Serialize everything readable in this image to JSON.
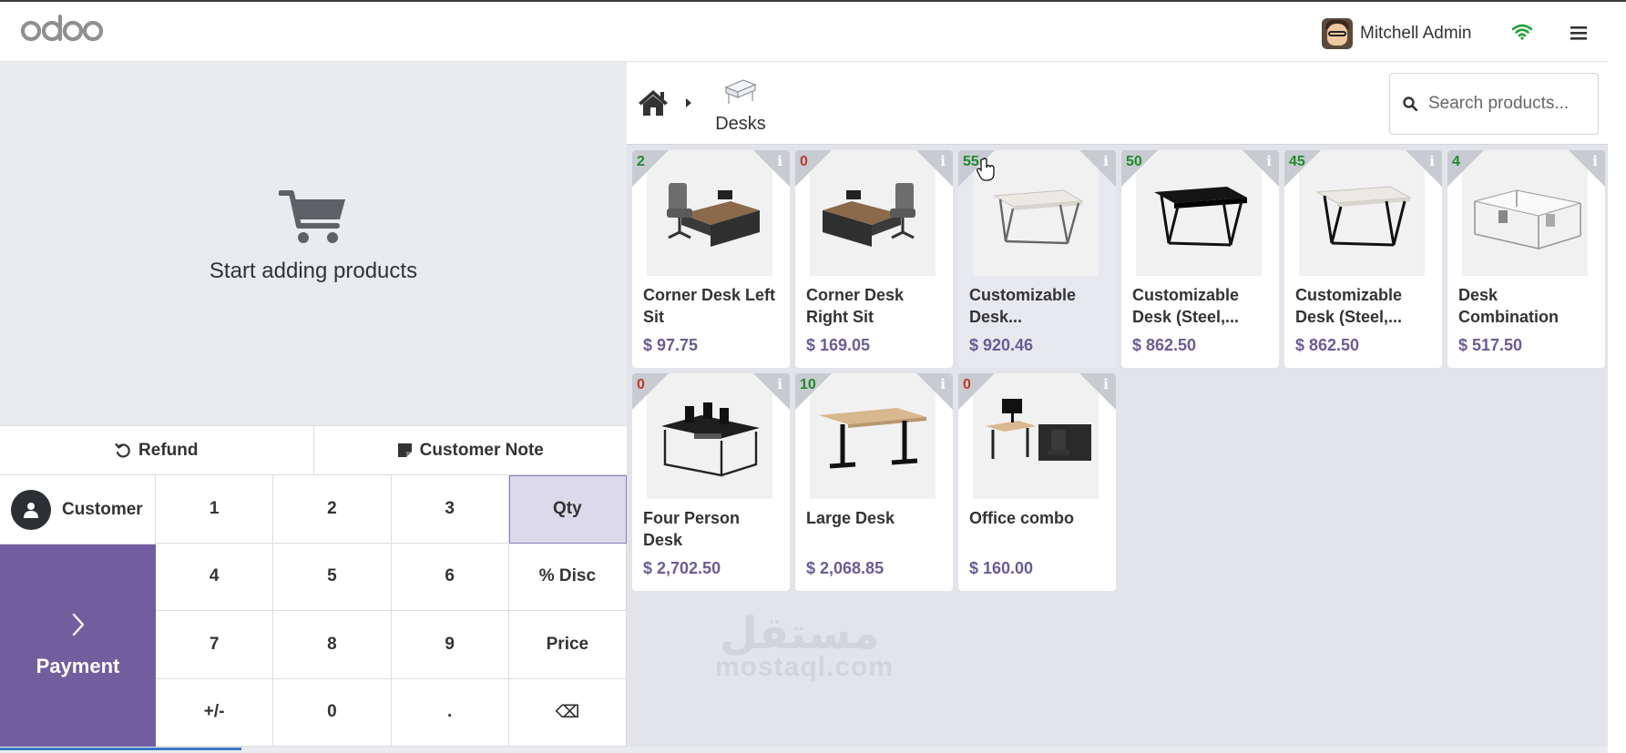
{
  "header": {
    "logo_text": "odoo",
    "user_name": "Mitchell Admin"
  },
  "cart": {
    "empty_message": "Start adding products"
  },
  "actions": {
    "refund_label": "Refund",
    "customer_note_label": "Customer Note"
  },
  "customer": {
    "label": "Customer"
  },
  "payment": {
    "label": "Payment"
  },
  "numpad": {
    "keys": [
      "1",
      "2",
      "3",
      "Qty",
      "4",
      "5",
      "6",
      "% Disc",
      "7",
      "8",
      "9",
      "Price",
      "+/-",
      "0",
      ".",
      "⌫"
    ],
    "active_key": "Qty"
  },
  "breadcrumb": {
    "category_label": "Desks"
  },
  "search": {
    "placeholder": "Search products..."
  },
  "products": [
    {
      "qty": "2",
      "name": "Corner Desk Left Sit",
      "price": "$ 97.75"
    },
    {
      "qty": "0",
      "name": "Corner Desk Right Sit",
      "price": "$ 169.05"
    },
    {
      "qty": "55",
      "name": "Customizable Desk...",
      "price": "$ 920.46"
    },
    {
      "qty": "50",
      "name": "Customizable Desk (Steel,...",
      "price": "$ 862.50"
    },
    {
      "qty": "45",
      "name": "Customizable Desk (Steel,...",
      "price": "$ 862.50"
    },
    {
      "qty": "4",
      "name": "Desk Combination",
      "price": "$ 517.50"
    },
    {
      "qty": "0",
      "name": "Four Person Desk",
      "price": "$ 2,702.50"
    },
    {
      "qty": "10",
      "name": "Large Desk",
      "price": "$ 2,068.85"
    },
    {
      "qty": "0",
      "name": "Office combo",
      "price": "$ 160.00"
    }
  ],
  "watermark": {
    "latin": "mostaql.com",
    "arabic": "مستقل"
  },
  "colors": {
    "accent": "#715e9f",
    "price": "#6b5b95",
    "qty_positive": "#1f8a2e",
    "qty_zero": "#c0392b"
  }
}
